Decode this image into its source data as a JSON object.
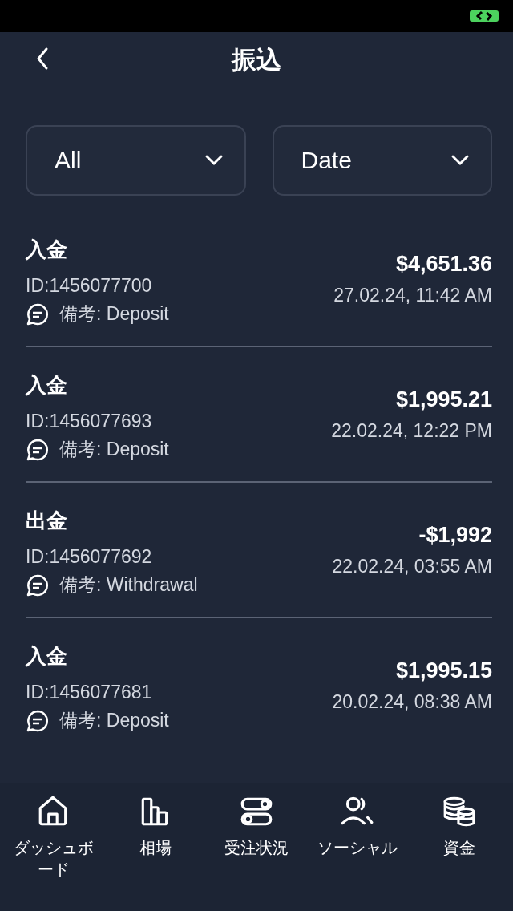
{
  "header": {
    "title": "振込"
  },
  "filters": [
    {
      "label": "All"
    },
    {
      "label": "Date"
    }
  ],
  "transactions": [
    {
      "type": "入金",
      "id": "ID:1456077700",
      "note": "備考: Deposit",
      "amount": "$4,651.36",
      "datetime": "27.02.24, 11:42 AM"
    },
    {
      "type": "入金",
      "id": "ID:1456077693",
      "note": "備考: Deposit",
      "amount": "$1,995.21",
      "datetime": "22.02.24, 12:22 PM"
    },
    {
      "type": "出金",
      "id": "ID:1456077692",
      "note": "備考: Withdrawal",
      "amount": "-$1,992",
      "datetime": "22.02.24, 03:55 AM"
    },
    {
      "type": "入金",
      "id": "ID:1456077681",
      "note": "備考: Deposit",
      "amount": "$1,995.15",
      "datetime": "20.02.24, 08:38 AM"
    }
  ],
  "nav": [
    {
      "kind": "home",
      "label": "ダッシュボード"
    },
    {
      "kind": "chart",
      "label": "相場"
    },
    {
      "kind": "toggles",
      "label": "受注状況"
    },
    {
      "kind": "people",
      "label": "ソーシャル"
    },
    {
      "kind": "coins",
      "label": "資金"
    }
  ]
}
